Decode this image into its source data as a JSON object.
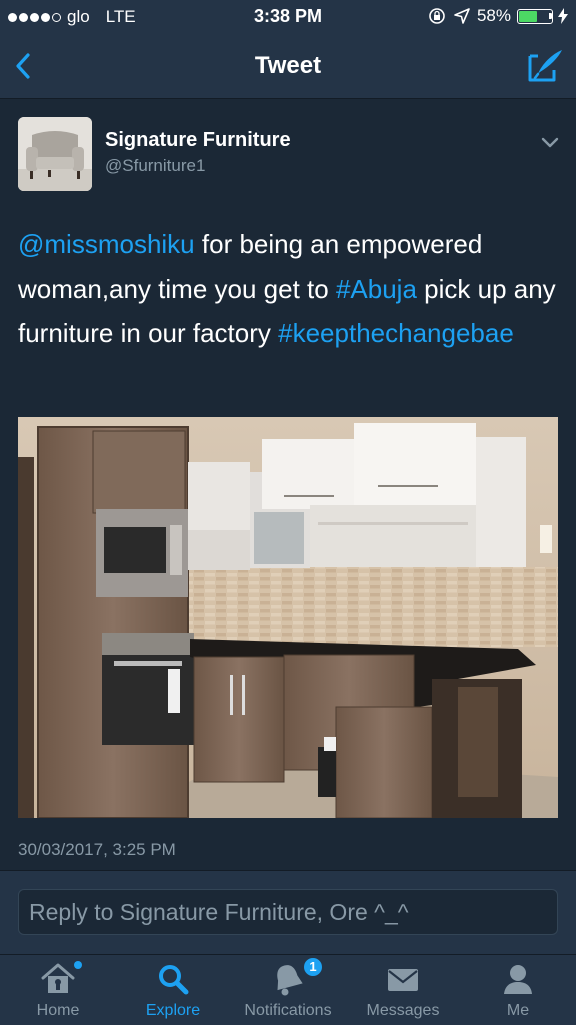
{
  "status_bar": {
    "carrier": "glo",
    "network": "LTE",
    "time": "3:38 PM",
    "battery_percent": "58%",
    "battery_level": 0.58,
    "signal_bars_filled": 4,
    "signal_bars_total": 5
  },
  "nav": {
    "title": "Tweet",
    "back_icon": "chevron-left-icon",
    "compose_icon": "compose-icon"
  },
  "tweet": {
    "author_name": "Signature Furniture",
    "author_handle": "@Sfurniture1",
    "text_parts": [
      {
        "text": "@missmoshiku",
        "link": true
      },
      {
        "text": " for being an empowered woman,any time you get to ",
        "link": false
      },
      {
        "text": "#Abuja",
        "link": true
      },
      {
        "text": " pick up any furniture in our factory ",
        "link": false
      },
      {
        "text": "#keepthechangebae",
        "link": true
      }
    ],
    "timestamp": "30/03/2017, 3:25 PM"
  },
  "reply": {
    "placeholder": "Reply to Signature Furniture, Ore ^_^"
  },
  "tabs": [
    {
      "label": "Home",
      "icon": "home-icon",
      "active": false
    },
    {
      "label": "Explore",
      "icon": "search-icon",
      "active": true
    },
    {
      "label": "Notifications",
      "icon": "bell-icon",
      "active": false,
      "badge": "1"
    },
    {
      "label": "Messages",
      "icon": "envelope-icon",
      "active": false
    },
    {
      "label": "Me",
      "icon": "person-icon",
      "active": false
    }
  ],
  "colors": {
    "accent": "#1da1f2",
    "background": "#1b2836",
    "bar": "#243447",
    "secondary_text": "#8899a6"
  }
}
